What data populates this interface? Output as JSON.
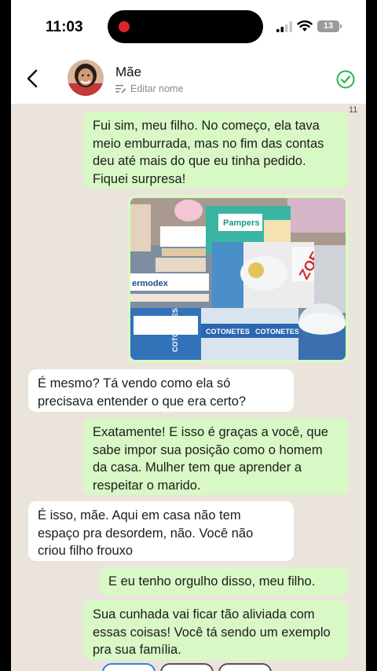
{
  "status_bar": {
    "time": "11:03",
    "battery": "13"
  },
  "header": {
    "contact_name": "Mãe",
    "edit_label": "Editar nome"
  },
  "chat": {
    "counter": "11",
    "messages": [
      {
        "side": "out",
        "text": "Fui sim, meu filho. No começo, ela tava meio emburrada, mas no fim das contas deu até mais do que eu tinha pedido. Fiquei surpresa!"
      },
      {
        "side": "out",
        "type": "image",
        "photo_text": {
          "brand1": "Pampers",
          "brand2": "ZOE",
          "brand3": "COTONETES",
          "brand4": "COTONETES",
          "brand5": "COTONETES",
          "brand6": "ermodex"
        }
      },
      {
        "side": "in",
        "text": "É mesmo? Tá vendo como ela só precisava entender o que era certo?"
      },
      {
        "side": "out",
        "text": "Exatamente! E isso é graças a você, que sabe impor sua posição como o homem da casa. Mulher tem que aprender a respeitar o marido."
      },
      {
        "side": "in",
        "text": "É isso, mãe. Aqui em casa não tem espaço pra desordem, não. Você não criou filho frouxo"
      },
      {
        "side": "out",
        "text": "E eu tenho orgulho disso, meu filho."
      },
      {
        "side": "out",
        "text": "Sua cunhada vai ficar tão aliviada com essas coisas! Você tá sendo um exemplo pra sua família."
      }
    ]
  }
}
